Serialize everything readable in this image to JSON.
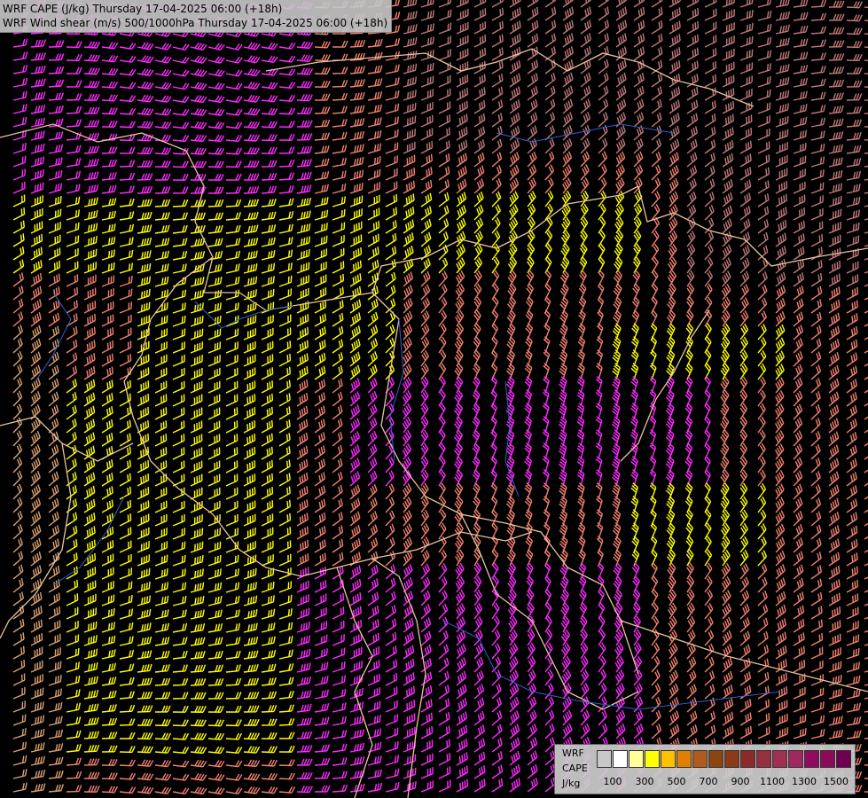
{
  "title": {
    "line1": "WRF CAPE (J/kg) Thursday 17-04-2025 06:00 (+18h)",
    "line2": "WRF Wind shear (m/s) 500/1000hPa Thursday 17-04-2025 06:00 (+18h)"
  },
  "legend": {
    "label_line1": "WRF",
    "label_line2": "CAPE",
    "label_line3": "J/kg",
    "ticks": [
      "100",
      "300",
      "500",
      "700",
      "900",
      "1100",
      "1300",
      "1500"
    ],
    "colors": [
      "#c8c8c8",
      "#ffffff",
      "#ffff99",
      "#ffff00",
      "#ffc000",
      "#e08000",
      "#b05a1e",
      "#8b4513",
      "#8b3a1a",
      "#8b2a2a",
      "#963040",
      "#a03050",
      "#a02860",
      "#900c60",
      "#8b0a5a",
      "#700050"
    ]
  },
  "colors": {
    "background": "#000000",
    "barb_magenta": "#ff2cff",
    "barb_yellow": "#ffff00",
    "barb_salmon": "#f08070",
    "barb_tan": "#d8a070",
    "barb_mauve": "#c07878",
    "border": "#e8c4a0",
    "river": "#3060d0"
  }
}
